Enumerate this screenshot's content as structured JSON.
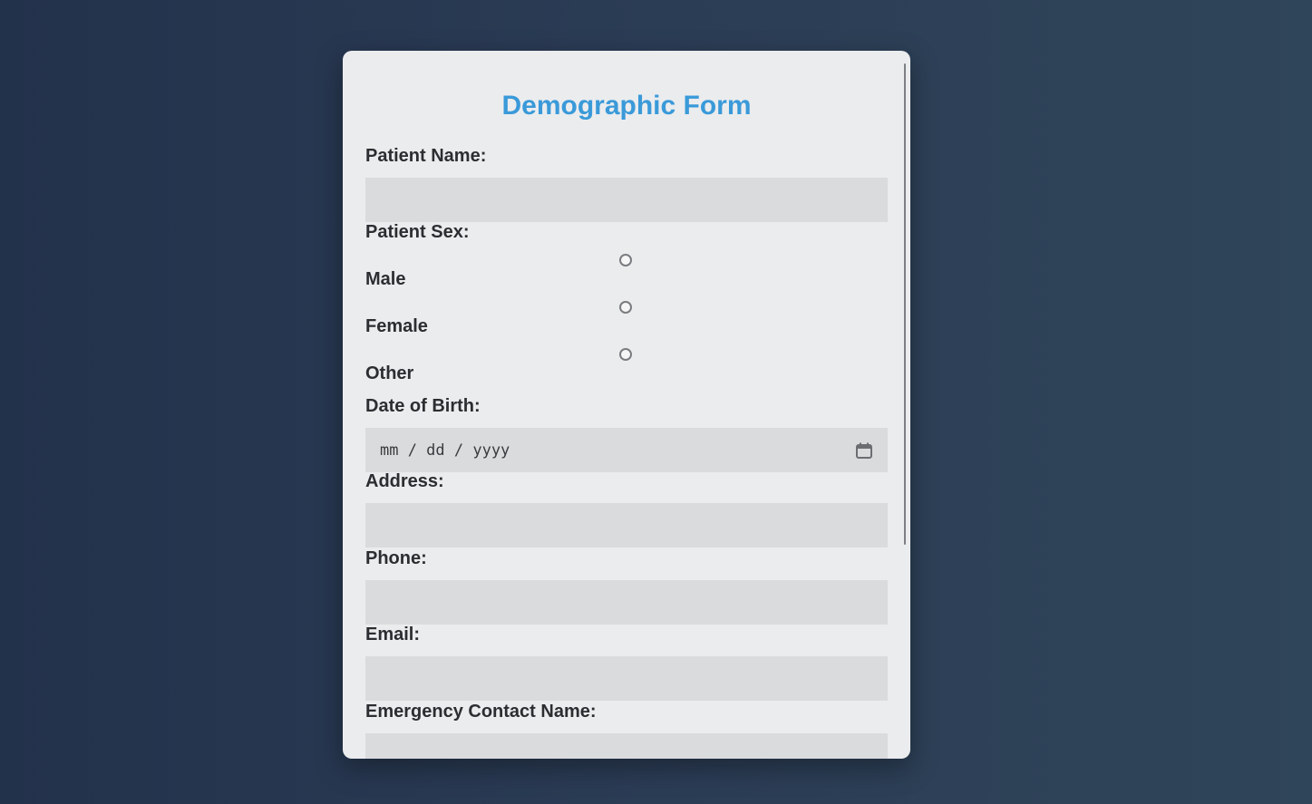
{
  "form": {
    "title": "Demographic Form",
    "patient_name": {
      "label": "Patient Name:",
      "value": ""
    },
    "patient_sex": {
      "label": "Patient Sex:",
      "options": [
        {
          "label": "Male",
          "selected": false
        },
        {
          "label": "Female",
          "selected": false
        },
        {
          "label": "Other",
          "selected": false
        }
      ]
    },
    "date_of_birth": {
      "label": "Date of Birth:",
      "placeholder": "mm / dd / yyyy"
    },
    "address": {
      "label": "Address:",
      "value": ""
    },
    "phone": {
      "label": "Phone:",
      "value": ""
    },
    "email": {
      "label": "Email:",
      "value": ""
    },
    "emergency_contact_name": {
      "label": "Emergency Contact Name:",
      "value": ""
    }
  },
  "icons": {
    "date_picker": "calendar-icon"
  },
  "colors": {
    "title": "#3a9ad9",
    "card_background": "#ebecee",
    "field_background": "#dadbdd",
    "page_background": "#2b3c55"
  }
}
